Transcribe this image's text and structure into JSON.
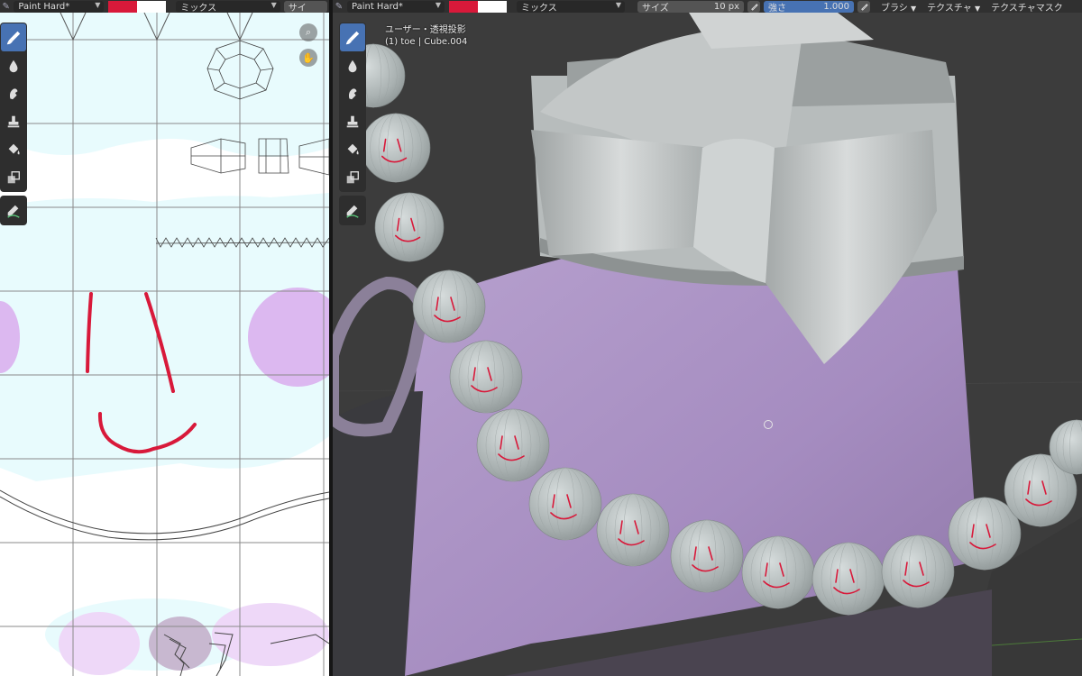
{
  "uv_header": {
    "brush_name": "Paint Hard*",
    "primary_color": "#d8193a",
    "secondary_color": "#ffffff",
    "blend_mode": "ミックス",
    "size_label_partial": "サイ"
  },
  "viewport_header": {
    "brush_name": "Paint Hard*",
    "primary_color": "#d8193a",
    "secondary_color": "#ffffff",
    "blend_mode": "ミックス",
    "size_label": "サイズ",
    "size_value": "10 px",
    "strength_label": "強さ",
    "strength_value": "1.000",
    "brush_menu": "ブラシ",
    "texture_menu": "テクスチャ",
    "texture_mask_menu": "テクスチャマスク"
  },
  "viewport": {
    "view_name": "ユーザー・透視投影",
    "object_name": "(1) toe | Cube.004"
  },
  "tools": [
    {
      "name": "draw-tool",
      "icon": "brush-icon",
      "active": true
    },
    {
      "name": "soften-tool",
      "icon": "drop-icon",
      "active": false
    },
    {
      "name": "smear-tool",
      "icon": "smear-icon",
      "active": false
    },
    {
      "name": "clone-tool",
      "icon": "stamp-icon",
      "active": false
    },
    {
      "name": "fill-tool",
      "icon": "bucket-icon",
      "active": false
    },
    {
      "name": "mask-tool",
      "icon": "mask-icon",
      "active": false
    },
    {
      "name": "annotate-tool",
      "icon": "annotate-icon",
      "active": false
    }
  ],
  "colors": {
    "accent": "#4772b3",
    "paint_red": "#d8193a",
    "uv_tint": "#e8fbfd",
    "purple_paint": "#dcb8f0",
    "sphere_grey": "#b8c0c0",
    "purple_body": "#a88fc0"
  }
}
